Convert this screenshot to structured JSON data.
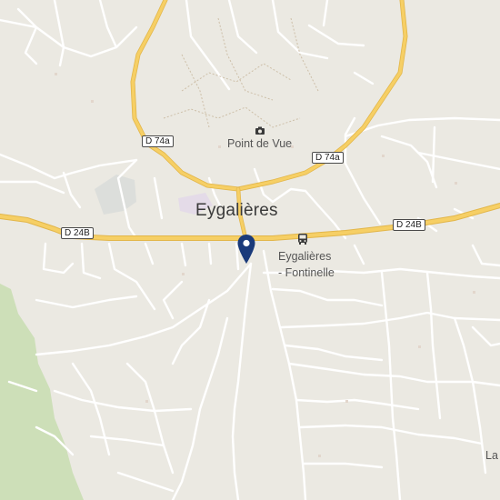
{
  "map": {
    "town_label": "Eygalières",
    "poi_viewpoint": {
      "label": "Point de Vue",
      "icon": "camera-icon"
    },
    "bus_stop": {
      "line1": "Eygalières",
      "line2": "- Fontinelle",
      "icon": "bus-icon"
    },
    "edge_label": "La",
    "roads": [
      {
        "ref": "D 74a"
      },
      {
        "ref": "D 74a"
      },
      {
        "ref": "D 24B"
      },
      {
        "ref": "D 24B"
      }
    ],
    "marker": {
      "icon": "location-pin-icon",
      "color": "#1a3a7a"
    },
    "colors": {
      "land": "#ebe9e2",
      "major_road": "#f6cf65",
      "minor_road": "#ffffff",
      "park": "#cddfb8",
      "campus": "#dcdedb",
      "poi_area": "#e4dbe8"
    }
  }
}
